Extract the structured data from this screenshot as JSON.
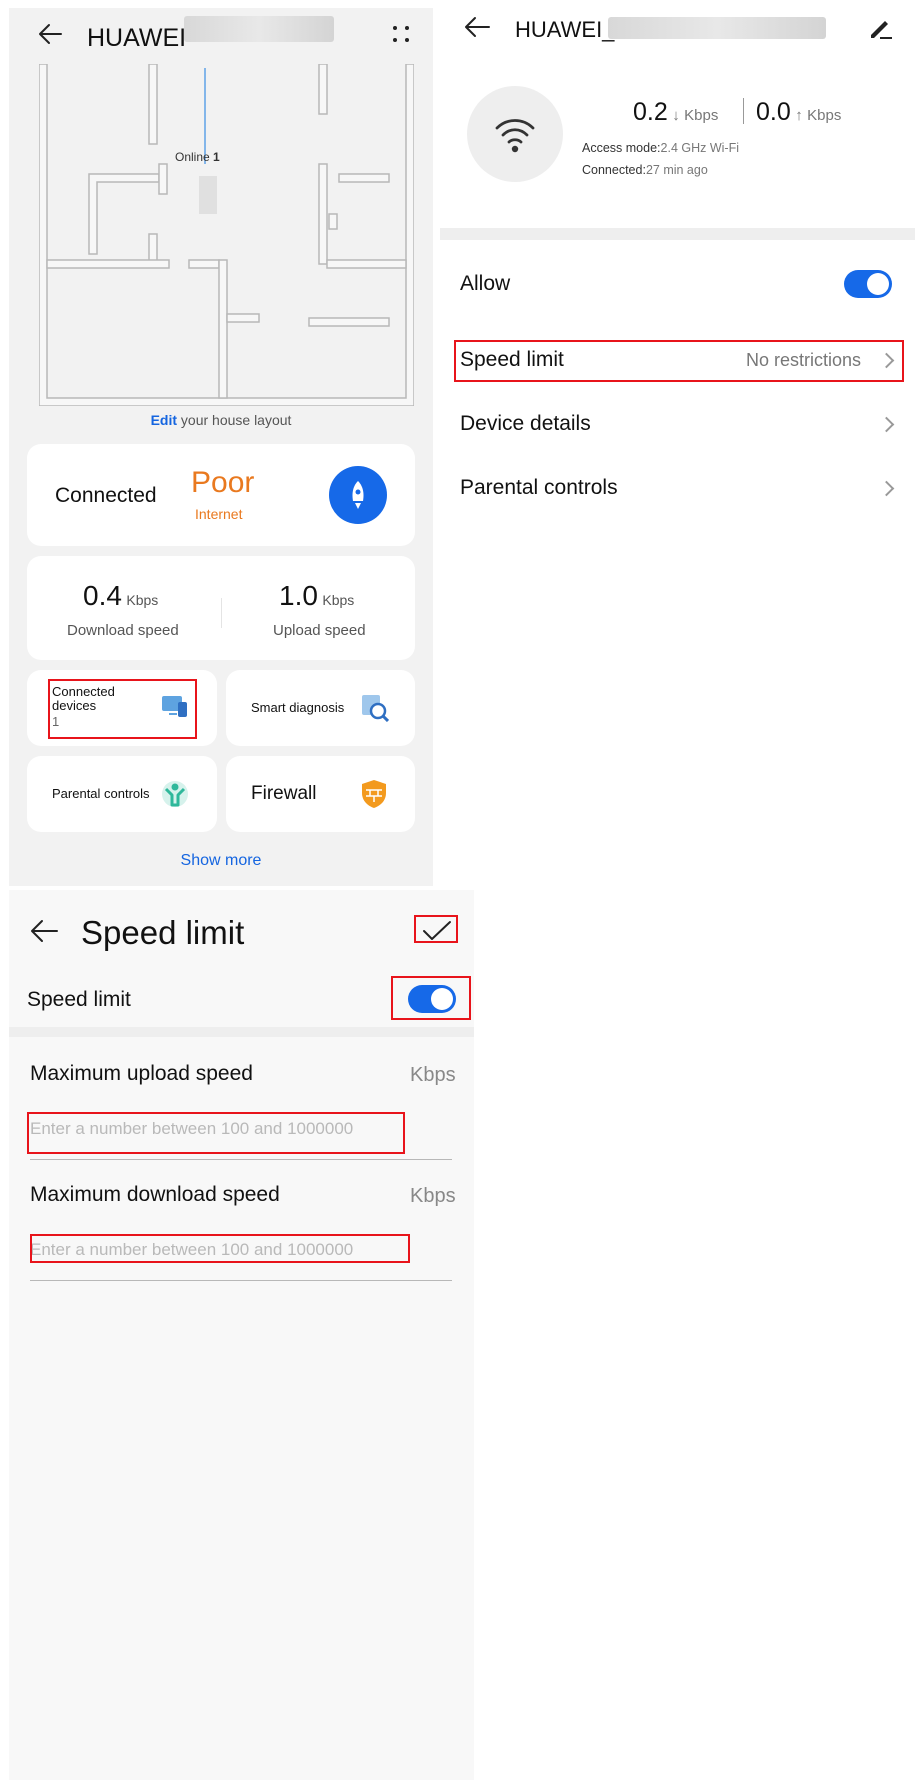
{
  "colors": {
    "accent": "#1669e8",
    "warning": "#e9791f",
    "highlight": "#e8141b"
  },
  "router_home": {
    "title": "HUAWEI",
    "online_label": "Online",
    "online_count": "1",
    "edit_link": "Edit",
    "edit_suffix": " your house layout",
    "status": {
      "label": "Connected",
      "quality": "Poor",
      "quality_sub": "Internet",
      "icon": "rocket-icon"
    },
    "download": {
      "value": "0.4",
      "unit": "Kbps",
      "caption": "Download speed"
    },
    "upload": {
      "value": "1.0",
      "unit": "Kbps",
      "caption": "Upload speed"
    },
    "tiles": {
      "connected_devices": {
        "label_line1": "Connected",
        "label_line2": "devices",
        "count": "1",
        "icon": "devices-icon"
      },
      "smart_diagnosis": {
        "label": "Smart diagnosis",
        "icon": "diagnosis-icon"
      },
      "parental_controls": {
        "label": "Parental controls",
        "icon": "child-icon"
      },
      "firewall": {
        "label": "Firewall",
        "icon": "firewall-shield-icon"
      }
    },
    "show_more": "Show more"
  },
  "device_detail": {
    "title": "HUAWEI_",
    "download_rate": "0.2",
    "upload_rate": "0.0",
    "rate_unit": "Kbps",
    "access_mode_label": "Access mode:",
    "access_mode_value": "2.4 GHz Wi-Fi",
    "connected_label": "Connected:",
    "connected_value": "27 min ago",
    "allow_label": "Allow",
    "allow_enabled": true,
    "rows": {
      "speed_limit": {
        "label": "Speed limit",
        "value": "No restrictions"
      },
      "device_details": {
        "label": "Device details"
      },
      "parental_controls": {
        "label": "Parental controls"
      }
    }
  },
  "speed_limit_page": {
    "title": "Speed limit",
    "toggle_label": "Speed limit",
    "toggle_enabled": true,
    "upload": {
      "label": "Maximum upload speed",
      "unit": "Kbps",
      "placeholder": "Enter a number between 100 and 1000000",
      "value": ""
    },
    "download": {
      "label": "Maximum download speed",
      "unit": "Kbps",
      "placeholder": "Enter a number between 100 and 1000000",
      "value": ""
    }
  }
}
